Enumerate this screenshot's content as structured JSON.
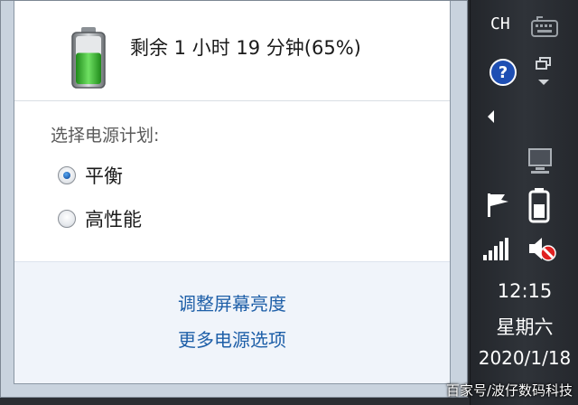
{
  "popup": {
    "remaining_text": "剩余 1 小时 19 分钟(65%)",
    "battery_percent": 65,
    "plan_label": "选择电源计划:",
    "plans": [
      {
        "label": "平衡",
        "selected": true
      },
      {
        "label": "高性能",
        "selected": false
      }
    ],
    "links": {
      "adjust_brightness": "调整屏幕亮度",
      "more_options": "更多电源选项"
    }
  },
  "tray": {
    "language": "CH",
    "time": "12:15",
    "weekday": "星期六",
    "date": "2020/1/18",
    "icons": [
      "keyboard-icon",
      "help-icon",
      "restore-icon",
      "show-hidden-arrow-icon",
      "monitor-icon",
      "action-center-flag-icon",
      "battery-icon",
      "network-signal-icon",
      "speaker-muted-icon"
    ]
  },
  "watermark": "百家号/波仔数码科技",
  "colors": {
    "battery_fill": "#3bbd2e",
    "link": "#1e5fa8",
    "taskbar": "#2b2e33",
    "radio_selected": "#1f5fb0"
  }
}
